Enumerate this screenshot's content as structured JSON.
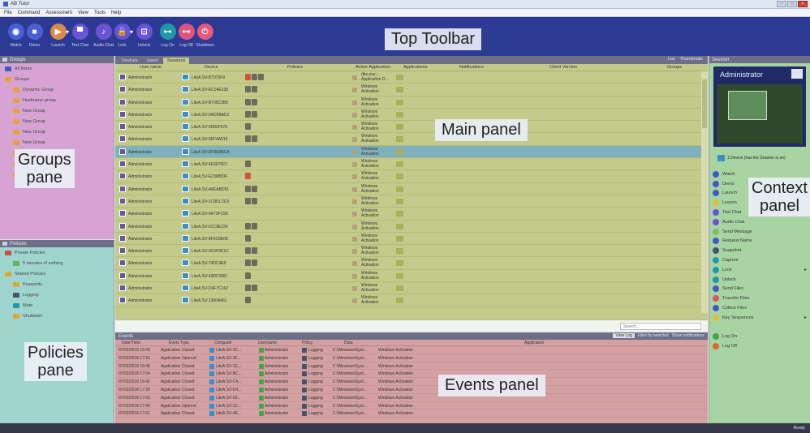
{
  "window": {
    "title": "AB Tutor",
    "controls": [
      "–",
      "□",
      "×"
    ]
  },
  "menu": [
    "File",
    "Command",
    "Assessment",
    "View",
    "Tools",
    "Help"
  ],
  "toolbar": {
    "overlay_label": "Top Toolbar",
    "buttons": [
      {
        "label": "Watch",
        "icon": "eye-icon",
        "color": "blue",
        "glyph": "◉"
      },
      {
        "label": "Demo",
        "icon": "monitor-icon",
        "color": "blue",
        "glyph": "■"
      },
      {
        "label": "Launch",
        "icon": "play-icon",
        "color": "orange",
        "glyph": "▶",
        "dropdown": true
      },
      {
        "label": "Text Chat",
        "icon": "chat-icon",
        "color": "purple",
        "glyph": "▀"
      },
      {
        "label": "Audio Chat",
        "icon": "microphone-icon",
        "color": "purple",
        "glyph": "♪"
      },
      {
        "label": "Lock",
        "icon": "lock-icon",
        "color": "purple",
        "glyph": "🔒",
        "dropdown": true
      },
      {
        "label": "Unlock",
        "icon": "unlock-icon",
        "color": "purple",
        "glyph": "⊡"
      },
      {
        "label": "Log On",
        "icon": "key-icon",
        "color": "teal",
        "glyph": "⊶"
      },
      {
        "label": "Log Off",
        "icon": "key-off-icon",
        "color": "pink",
        "glyph": "⊶"
      },
      {
        "label": "Shutdown",
        "icon": "power-icon",
        "color": "red",
        "glyph": "⏻"
      }
    ]
  },
  "groups": {
    "header": "Groups",
    "overlay_label_1": "Groups",
    "overlay_label_2": "pane",
    "items": [
      {
        "label": "All Items",
        "color": "blue",
        "indent": 0
      },
      {
        "label": "Groups",
        "color": "orange",
        "indent": 0
      },
      {
        "label": "Dynamic Group",
        "color": "orange",
        "indent": 1
      },
      {
        "label": "Hostname group",
        "color": "orange",
        "indent": 1
      },
      {
        "label": "New Group",
        "color": "orange",
        "indent": 1
      },
      {
        "label": "New Group",
        "color": "orange",
        "indent": 1
      },
      {
        "label": "New Group",
        "color": "orange",
        "indent": 1
      },
      {
        "label": "New Group",
        "color": "orange",
        "indent": 1
      },
      {
        "label": "New Group",
        "color": "orange",
        "indent": 1
      },
      {
        "label": "New Group",
        "color": "orange",
        "indent": 1
      },
      {
        "label": "Other",
        "color": "orange",
        "indent": 1
      }
    ]
  },
  "policies": {
    "header": "Policies",
    "overlay_label_1": "Policies",
    "overlay_label_2": "pane",
    "items": [
      {
        "label": "Private Policies",
        "color": "red",
        "indent": 0
      },
      {
        "label": "5 minutes of nothing",
        "color": "green",
        "indent": 1
      },
      {
        "label": "Shared Policies",
        "color": "orange",
        "indent": 0
      },
      {
        "label": "Keywords",
        "color": "orange",
        "indent": 1
      },
      {
        "label": "Logging",
        "color": "dark",
        "indent": 1
      },
      {
        "label": "Mute",
        "color": "teal",
        "indent": 1
      },
      {
        "label": "Shutdown",
        "color": "orange",
        "indent": 1
      }
    ]
  },
  "main": {
    "tabs": [
      "Devices",
      "Users",
      "Sessions"
    ],
    "active_tab": 2,
    "view_toggle": [
      "List",
      "Thumbnails"
    ],
    "overlay_label": "Main panel",
    "columns": [
      "User name",
      "Device",
      "Policies",
      "Active Application",
      "Applications",
      "Notifications",
      "Client Version",
      "Groups"
    ],
    "rows": [
      {
        "user": "Administrator",
        "device": "LiteA.SV-B7070F9",
        "policies": [
          "red",
          "gray",
          "gray"
        ],
        "app": "dbs.exe - Application D..."
      },
      {
        "user": "Administrator",
        "device": "LiteA.SV-EC04E238",
        "policies": [
          "gray",
          "gray"
        ],
        "app": "Windows Activation"
      },
      {
        "user": "Administrator",
        "device": "LiteA.SV-B705C2B5",
        "policies": [
          "gray",
          "gray"
        ],
        "app": "Windows Activation"
      },
      {
        "user": "Administrator",
        "device": "LiteA.SV-9AD5BAD1",
        "policies": [
          "gray",
          "gray"
        ],
        "app": "Windows Activation"
      },
      {
        "user": "Administrator",
        "device": "LiteA.SV-6D82F973",
        "policies": [
          "gray"
        ],
        "app": "Windows Activation"
      },
      {
        "user": "Administrator",
        "device": "LiteA.SV-9EF4A816",
        "policies": [
          "gray",
          "gray"
        ],
        "app": "Windows Activation"
      },
      {
        "user": "Administrator",
        "device": "LiteA.SV-DF9E5BCA",
        "policies": [],
        "app": "Windows Activation",
        "selected": true
      },
      {
        "user": "Administrator",
        "device": "LiteA.SV-4E3670FC",
        "policies": [
          "gray"
        ],
        "app": "Windows Activation"
      },
      {
        "user": "Administrator",
        "device": "LiteA.SV-E236B83F",
        "policies": [
          "red"
        ],
        "app": "Windows Activation"
      },
      {
        "user": "Administrator",
        "device": "LiteA.SV-A8EABD51",
        "policies": [
          "gray",
          "gray"
        ],
        "app": "Windows Activation"
      },
      {
        "user": "Administrator",
        "device": "LiteA.SV-1C951 2C6",
        "policies": [
          "gray",
          "gray"
        ],
        "app": "Windows Activation"
      },
      {
        "user": "Administrator",
        "device": "LiteA.SV-0A73FC58",
        "policies": [],
        "app": "Windows Activation"
      },
      {
        "user": "Administrator",
        "device": "LiteA.SV-61C9E226",
        "policies": [
          "gray",
          "gray"
        ],
        "app": "Windows Activation"
      },
      {
        "user": "Administrator",
        "device": "LiteA.SV-8F0C6E08",
        "policies": [
          "gray"
        ],
        "app": "Windows Activation"
      },
      {
        "user": "Administrator",
        "device": "LiteA.SV-0C5F8D1C",
        "policies": [
          "gray",
          "gray"
        ],
        "app": "Windows Activation"
      },
      {
        "user": "Administrator",
        "device": "LiteA.SV-74DC4E0",
        "policies": [
          "gray",
          "gray"
        ],
        "app": "Windows Activation"
      },
      {
        "user": "Administrator",
        "device": "LiteA.SV-49DF2861",
        "policies": [
          "gray"
        ],
        "app": "Windows Activation"
      },
      {
        "user": "Administrator",
        "device": "LiteA.SV-D4F7C162",
        "policies": [
          "gray",
          "gray"
        ],
        "app": "Windows Activation"
      },
      {
        "user": "Administrator",
        "device": "LiteA.SV-1300A461",
        "policies": [
          "gray"
        ],
        "app": "Windows Activation"
      }
    ],
    "search_placeholder": "Search..."
  },
  "events": {
    "header": "Events",
    "controls": [
      "View Log",
      "Filter by selected",
      "Show notifications"
    ],
    "overlay_label": "Events panel",
    "columns": [
      "Date/Time",
      "Event Type",
      "Computer",
      "Username",
      "Policy",
      "Data",
      "Application"
    ],
    "rows": [
      {
        "time": "07/02/2018 16:43",
        "type": "Application Closed",
        "computer": "LiteA.SV-3C...",
        "user": "Administrator",
        "policy": "Logging",
        "data": "C:\\Windows\\Syst...",
        "app": "Windows Activation"
      },
      {
        "time": "07/02/2018 17:16",
        "type": "Application Opened",
        "computer": "LiteA.SV-3F...",
        "user": "Administrator",
        "policy": "Logging",
        "data": "C:\\Windows\\Syst...",
        "app": "Windows Activation"
      },
      {
        "time": "07/02/2018 16:40",
        "type": "Application Closed",
        "computer": "LiteA.SV-1C...",
        "user": "Administrator",
        "policy": "Logging",
        "data": "C:\\Windows\\Syst...",
        "app": "Windows Activation"
      },
      {
        "time": "07/02/2018 17:04",
        "type": "Application Closed",
        "computer": "LiteA.SV-BC...",
        "user": "Administrator",
        "policy": "Logging",
        "data": "C:\\Windows\\Syst...",
        "app": "Windows Activation"
      },
      {
        "time": "07/02/2018 16:42",
        "type": "Application Closed",
        "computer": "LiteA.SV-C4...",
        "user": "Administrator",
        "policy": "Logging",
        "data": "C:\\Windows\\Syst...",
        "app": "Windows Activation"
      },
      {
        "time": "07/02/2018 17:28",
        "type": "Application Closed",
        "computer": "LiteA.SV-D4...",
        "user": "Administrator",
        "policy": "Logging",
        "data": "C:\\Windows\\Syst...",
        "app": "Windows Activation"
      },
      {
        "time": "07/02/2018 17:03",
        "type": "Application Closed",
        "computer": "LiteA.SV-93...",
        "user": "Administrator",
        "policy": "Logging",
        "data": "C:\\Windows\\Syst...",
        "app": "Windows Activation"
      },
      {
        "time": "07/02/2018 17:40",
        "type": "Application Opened",
        "computer": "LiteA.SV-1C...",
        "user": "Administrator",
        "policy": "Logging",
        "data": "C:\\Windows\\Syst...",
        "app": "Windows Activation"
      },
      {
        "time": "07/02/2018 17:01",
        "type": "Application Closed",
        "computer": "LiteA.SV-4E...",
        "user": "Administrator",
        "policy": "Logging",
        "data": "C:\\Windows\\Syst...",
        "app": "Windows Activation"
      }
    ]
  },
  "context": {
    "header": "Session",
    "user": "Administrator",
    "overlay_label_1": "Context",
    "overlay_label_2": "panel",
    "device_line": "1 Device (has the Session is on)",
    "actions": [
      {
        "label": "Watch",
        "color": "#3f5cc6"
      },
      {
        "label": "Demo",
        "color": "#3f5cc6"
      },
      {
        "label": "Launch",
        "color": "#3f5cc6",
        "arrow": true
      },
      {
        "label": "Lesson",
        "color": "#d9c23a"
      },
      {
        "label": "Text Chat",
        "color": "#6a54d6"
      },
      {
        "label": "Audio Chat",
        "color": "#6a54d6"
      },
      {
        "label": "Send Message",
        "color": "#7fbf5e"
      },
      {
        "label": "Request Name",
        "color": "#3f5cc6"
      },
      {
        "label": "Snapshot",
        "color": "#44546a"
      },
      {
        "label": "Capture",
        "color": "#1d9aa6"
      },
      {
        "label": "Lock",
        "color": "#1d9aa6",
        "arrow": true
      },
      {
        "label": "Unlock",
        "color": "#1d9aa6"
      },
      {
        "label": "Send Files",
        "color": "#3f5cc6"
      },
      {
        "label": "Transfer Files",
        "color": "#e05555"
      },
      {
        "label": "Collect Files",
        "color": "#3f5cc6"
      },
      {
        "label": "Key Sequences",
        "color": "#d9c23a",
        "arrow": true
      },
      {
        "label": "",
        "color": ""
      },
      {
        "label": "Log On",
        "color": "#4aa34a"
      },
      {
        "label": "Log Off",
        "color": "#d96a3a"
      }
    ]
  },
  "status": {
    "text": "Ready"
  }
}
